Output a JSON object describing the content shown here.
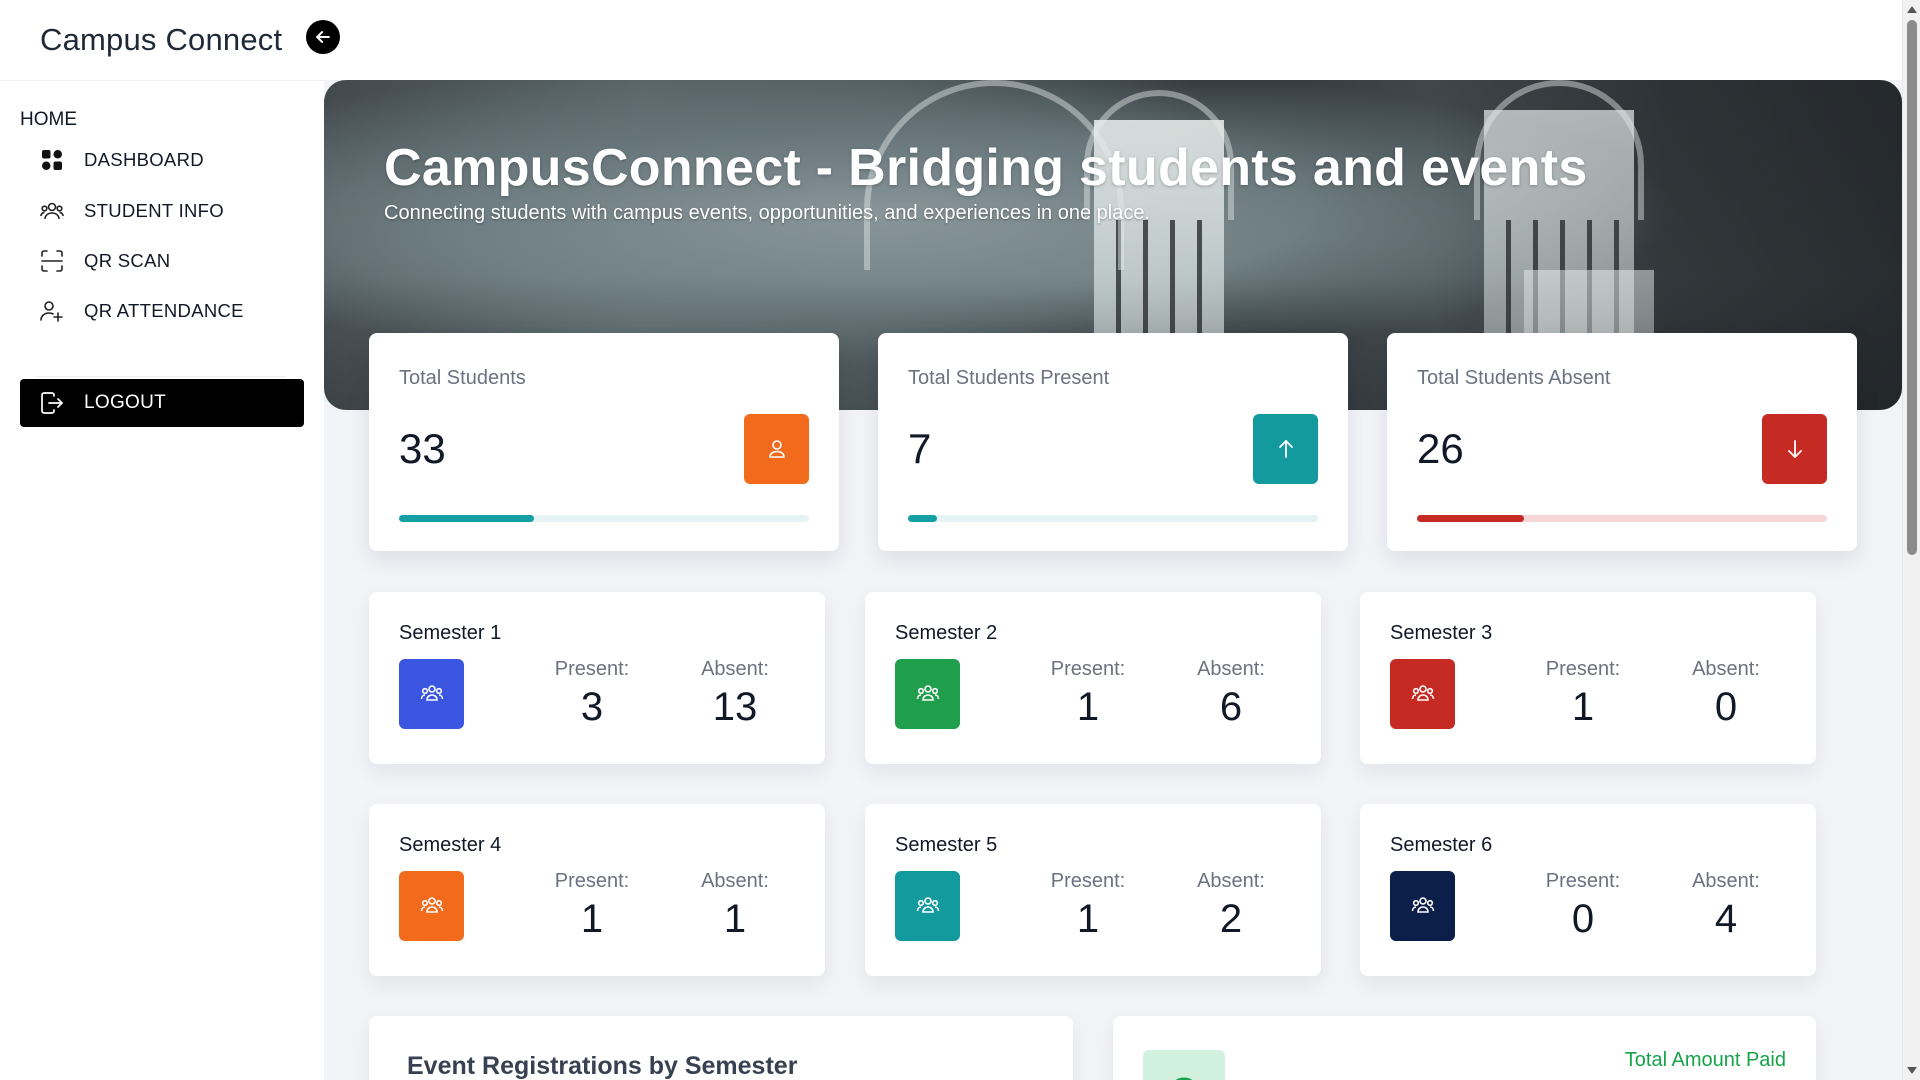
{
  "app": {
    "brand": "Campus Connect"
  },
  "sidebar": {
    "section_label": "HOME",
    "items": [
      {
        "label": "DASHBOARD",
        "icon": "dashboard-grid-icon"
      },
      {
        "label": "STUDENT INFO",
        "icon": "users-icon"
      },
      {
        "label": "QR SCAN",
        "icon": "qr-scan-icon"
      },
      {
        "label": "QR ATTENDANCE",
        "icon": "user-plus-icon"
      }
    ],
    "logout_label": "LOGOUT"
  },
  "hero": {
    "title": "CampusConnect - Bridging students and events",
    "subtitle": "Connecting students with campus events, opportunities, and experiences in one place."
  },
  "stats": [
    {
      "title": "Total Students",
      "value": "33",
      "icon": "user-icon",
      "color": "#f26b1d",
      "bar_color": "#16a0a5",
      "track_color": "#e6f3f4",
      "progress": 0.33
    },
    {
      "title": "Total Students Present",
      "value": "7",
      "icon": "arrow-up-icon",
      "color": "#139a9f",
      "bar_color": "#16a0a5",
      "track_color": "#e6f3f4",
      "progress": 0.07
    },
    {
      "title": "Total Students Absent",
      "value": "26",
      "icon": "arrow-down-icon",
      "color": "#c52b22",
      "bar_color": "#c52b22",
      "track_color": "#f6d6d6",
      "progress": 0.26
    }
  ],
  "semesters": [
    {
      "title": "Semester 1",
      "present_label": "Present:",
      "present": "3",
      "absent_label": "Absent:",
      "absent": "13",
      "color": "#3a56e0"
    },
    {
      "title": "Semester 2",
      "present_label": "Present:",
      "present": "1",
      "absent_label": "Absent:",
      "absent": "6",
      "color": "#1f9e4c"
    },
    {
      "title": "Semester 3",
      "present_label": "Present:",
      "present": "1",
      "absent_label": "Absent:",
      "absent": "0",
      "color": "#c52b22"
    },
    {
      "title": "Semester 4",
      "present_label": "Present:",
      "present": "1",
      "absent_label": "Absent:",
      "absent": "1",
      "color": "#f26b1d"
    },
    {
      "title": "Semester 5",
      "present_label": "Present:",
      "present": "1",
      "absent_label": "Absent:",
      "absent": "2",
      "color": "#139a9f"
    },
    {
      "title": "Semester 6",
      "present_label": "Present:",
      "present": "0",
      "absent_label": "Absent:",
      "absent": "4",
      "color": "#0b1f4a"
    }
  ],
  "bottom": {
    "event_title": "Event Registrations by Semester",
    "paid_label": "Total Amount Paid"
  }
}
